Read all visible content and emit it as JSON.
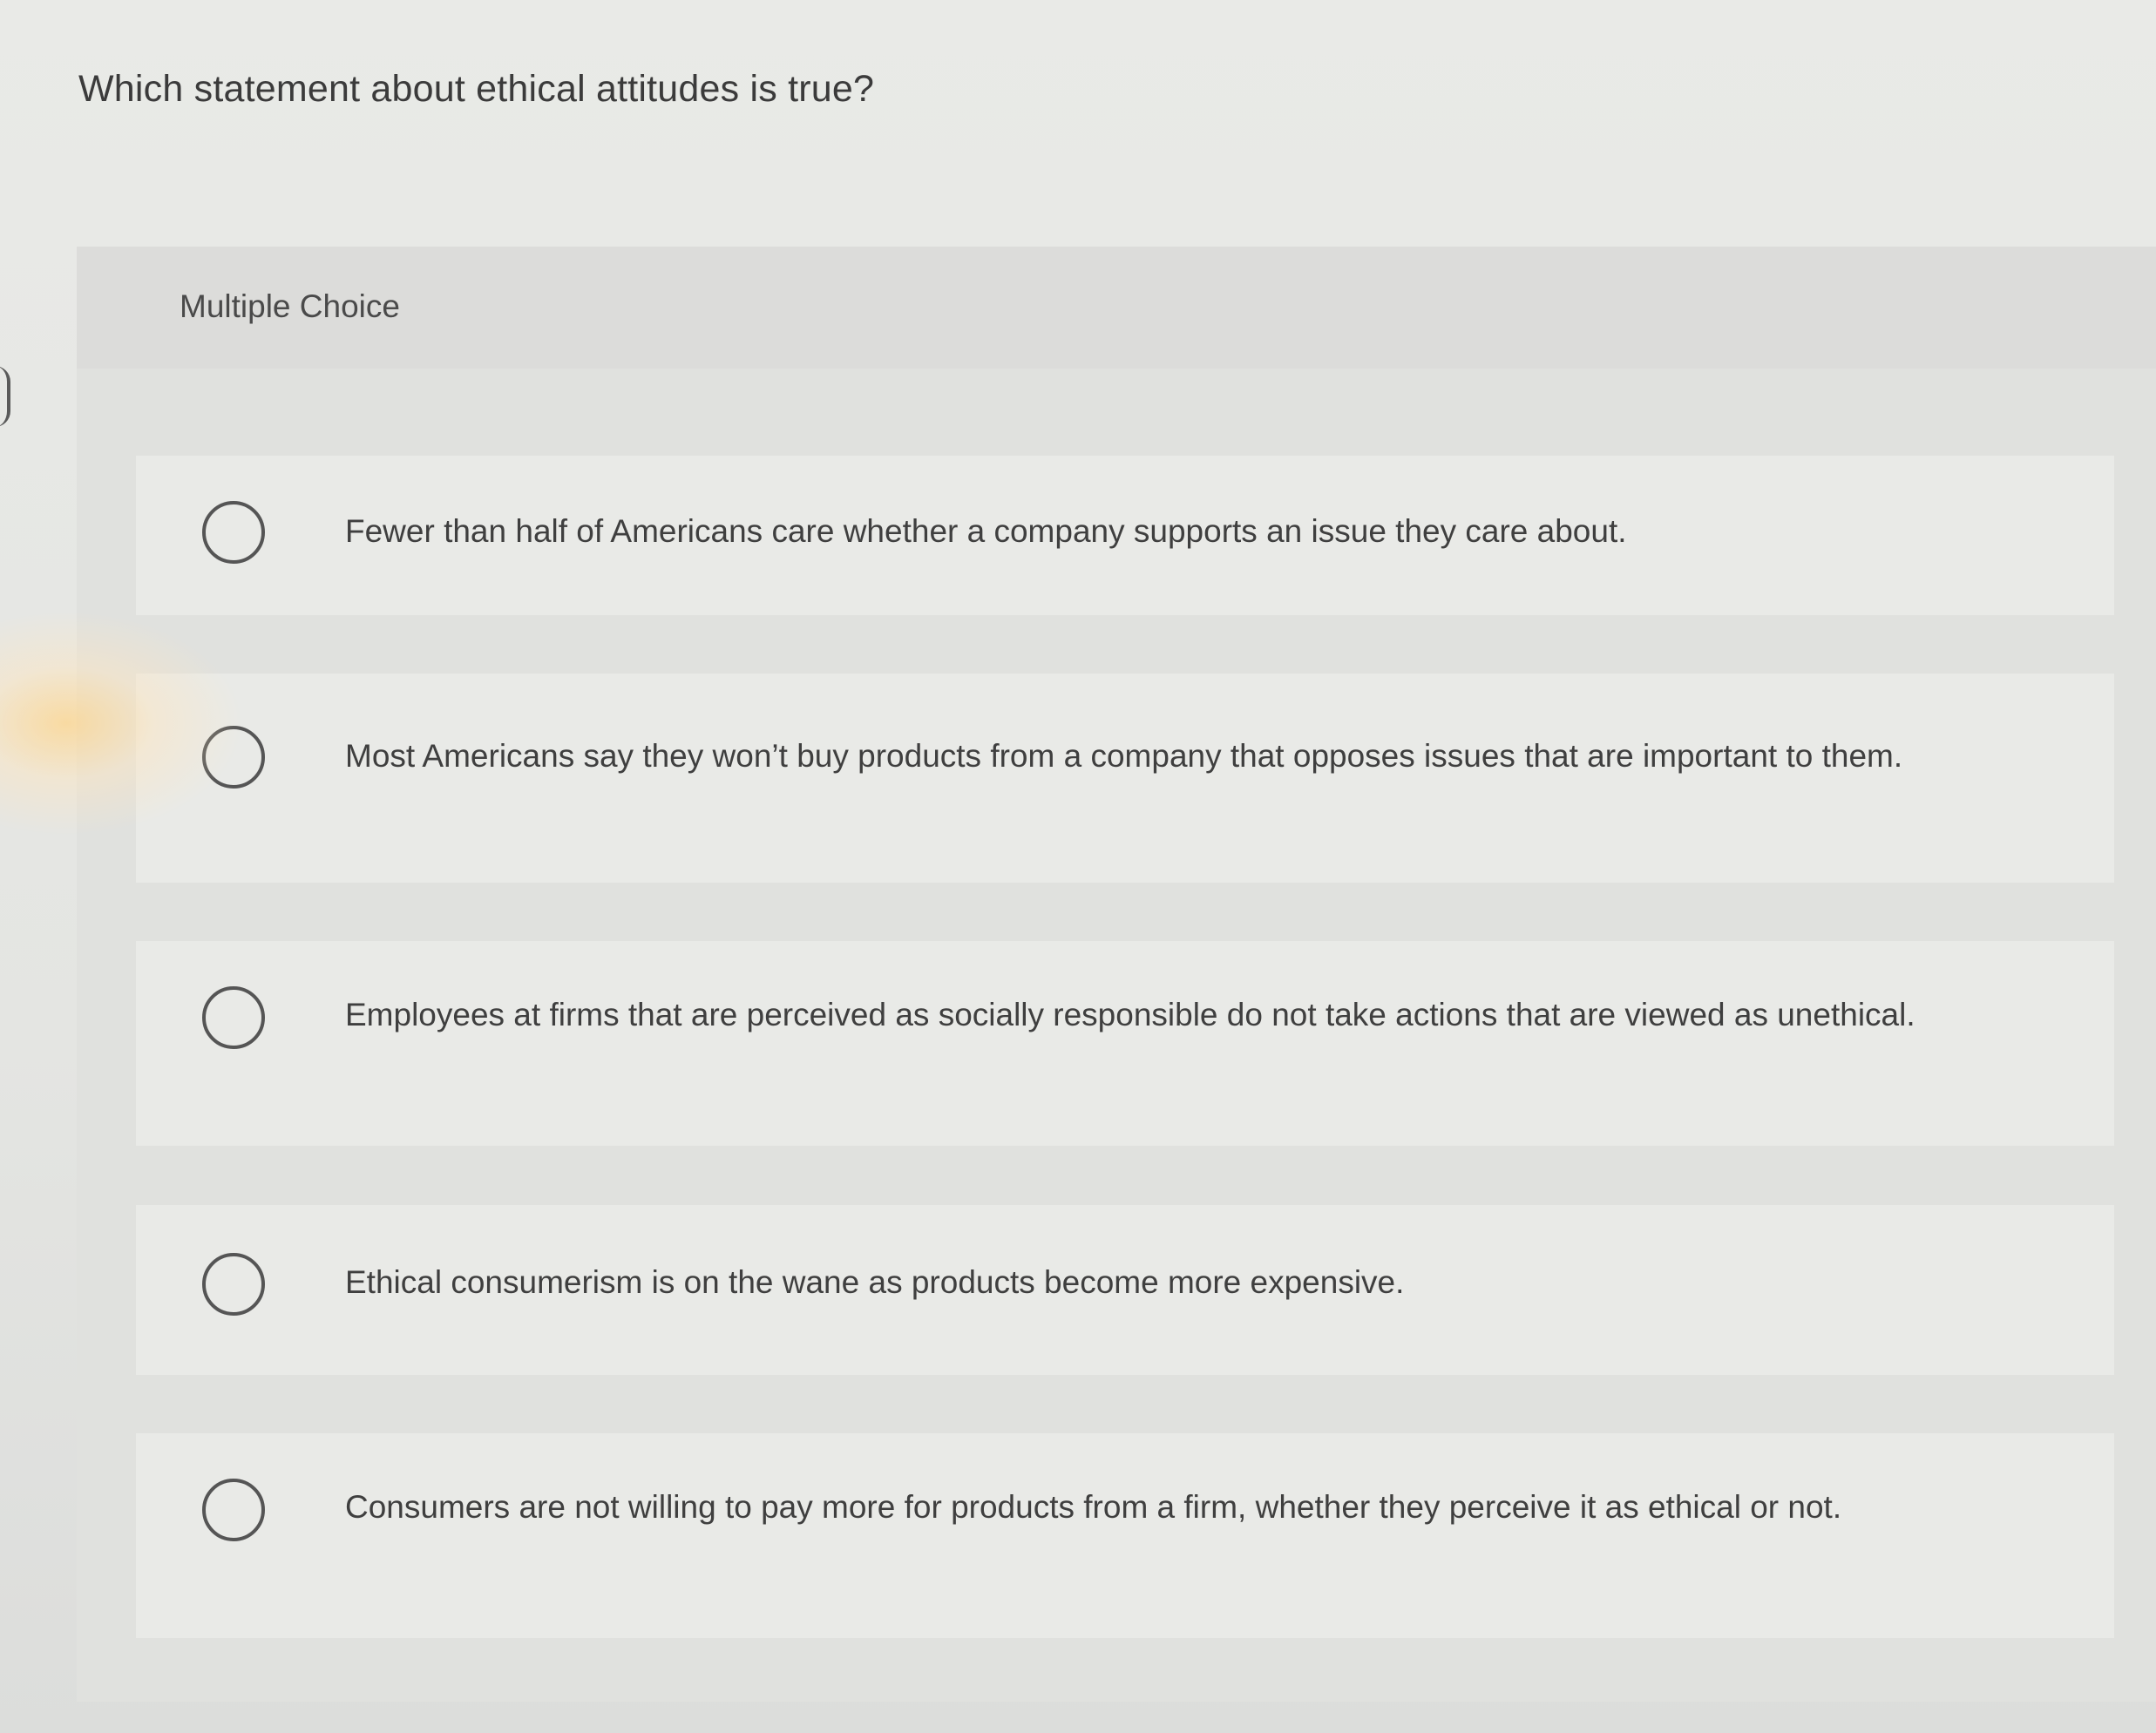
{
  "question": {
    "text": "Which statement about ethical attitudes is true?"
  },
  "section": {
    "label": "Multiple Choice"
  },
  "choices": [
    {
      "text": "Fewer than half of Americans care whether a company supports an issue they care about."
    },
    {
      "text": "Most Americans say they won’t buy products from a company that opposes issues that are important to them."
    },
    {
      "text": "Employees at firms that are perceived as socially responsible do not take actions that are viewed as unethical."
    },
    {
      "text": "Ethical consumerism is on the wane as products become more expensive."
    },
    {
      "text": "Consumers are not willing to pay more for products from a firm, whether they perceive it as ethical or not."
    }
  ]
}
